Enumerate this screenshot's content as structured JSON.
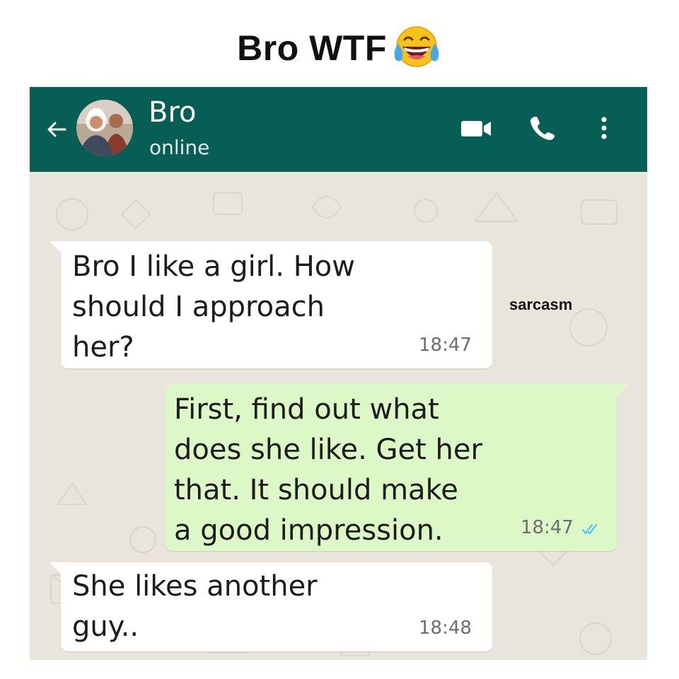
{
  "meme_title": "Bro WTF",
  "watermark": "sarcasm",
  "header": {
    "contact_name": "Bro",
    "status": "online",
    "bg_color": "#075e54",
    "icons": [
      "back-arrow-icon",
      "video-call-icon",
      "voice-call-icon",
      "more-options-icon"
    ]
  },
  "messages": [
    {
      "direction": "incoming",
      "text": "Bro I like a girl. How\nshould  I approach\nher?",
      "time": "18:47"
    },
    {
      "direction": "outgoing",
      "text": "First, find out what\ndoes she like. Get her\nthat. It should make\na good impression.",
      "time": "18:47",
      "status_icon": "double-check-icon"
    },
    {
      "direction": "incoming",
      "text": "She likes another\nguy..",
      "time": "18:48"
    }
  ],
  "colors": {
    "incoming_bubble": "#ffffff",
    "outgoing_bubble": "#dcf8c6",
    "chat_background": "#e9e5dd",
    "read_check": "#4fc3f7"
  }
}
